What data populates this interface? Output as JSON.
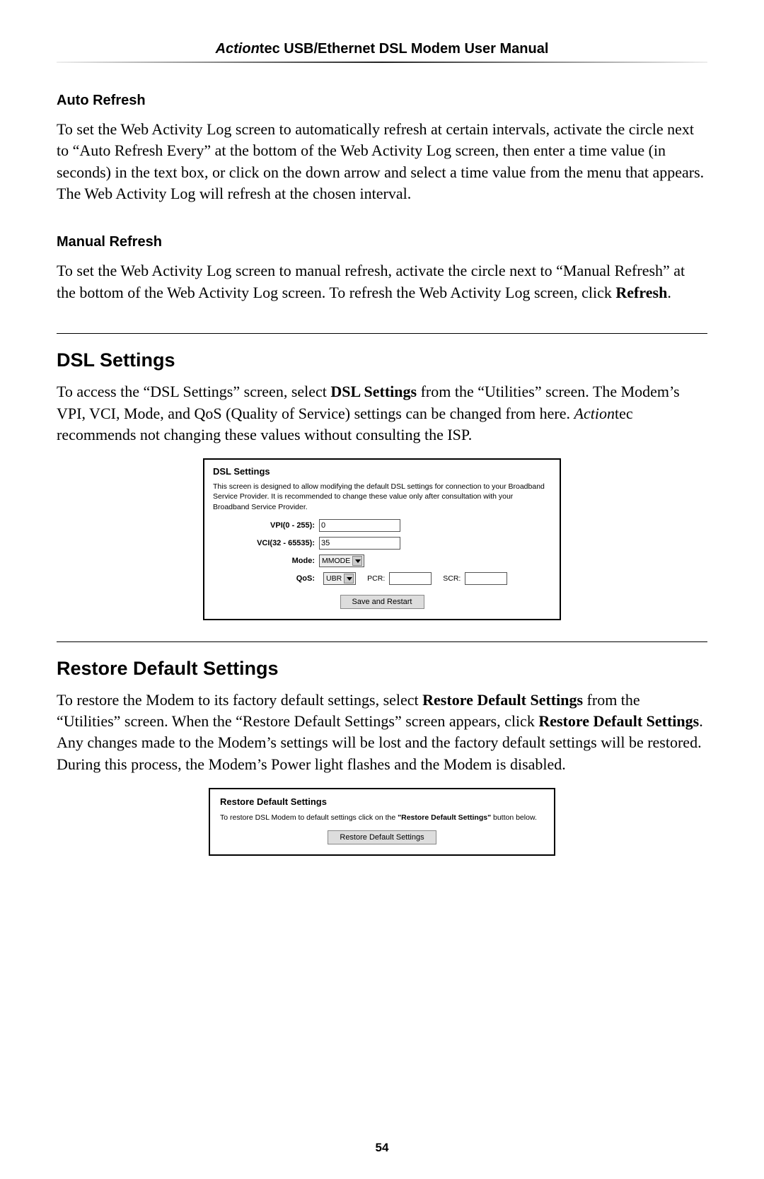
{
  "header": {
    "brand_italic": "Action",
    "brand_rest": "tec USB/Ethernet DSL Modem User Manual"
  },
  "sections": {
    "auto_refresh": {
      "heading": "Auto Refresh",
      "body": "To set the Web Activity Log screen to automatically refresh at certain intervals, activate the circle next to “Auto Refresh Every” at the bottom of the Web Activity Log screen, then enter a time value (in seconds) in the text box, or click on the down arrow and select a time value from the menu that appears. The Web Activity Log will refresh at the chosen interval."
    },
    "manual_refresh": {
      "heading": "Manual Refresh",
      "body_pre": "To set the Web Activity Log screen to manual refresh, activate the circle next to “Manual Refresh” at the bottom of the Web Activity Log screen. To refresh the Web Activity Log screen, click ",
      "body_bold": "Refresh",
      "body_post": "."
    },
    "dsl_settings": {
      "heading": "DSL Settings",
      "body_1": "To access the “DSL Settings” screen, select ",
      "body_bold1": "DSL Settings",
      "body_2": " from the “Utilities” screen. The Modem’s VPI, VCI, Mode, and QoS (Quality of Service) settings can be changed from here. ",
      "body_italic": "Action",
      "body_3": "tec recommends not changing these values without consulting the ISP."
    },
    "restore": {
      "heading": "Restore Default Settings",
      "body_1": "To restore the Modem to its factory default settings, select ",
      "body_bold1": "Restore Default Settings",
      "body_2": " from the “Utilities” screen. When the “Restore Default Settings” screen appears, click ",
      "body_bold2": "Restore Default Settings",
      "body_3": ". Any changes made to the Modem’s settings will be lost and the factory default settings will be restored. During this process, the Modem’s Power light flashes and the Modem is disabled."
    }
  },
  "dsl_panel": {
    "title": "DSL Settings",
    "desc": "This screen is designed to allow modifying the default DSL settings for connection to your Broadband Service Provider. It is recommended to change these value only after consultation with your Broadband Service Provider.",
    "vpi_label": "VPI(0 - 255):",
    "vpi_value": "0",
    "vci_label": "VCI(32 - 65535):",
    "vci_value": "35",
    "mode_label": "Mode:",
    "mode_value": "MMODE",
    "qos_label": "QoS:",
    "qos_value": "UBR",
    "pcr_label": "PCR:",
    "scr_label": "SCR:",
    "button": "Save and Restart"
  },
  "restore_panel": {
    "title": "Restore Default Settings",
    "desc_pre": "To restore DSL Modem to default settings click on the ",
    "desc_bold": "\"Restore Default Settings\"",
    "desc_post": " button below.",
    "button": "Restore Default Settings"
  },
  "page_number": "54"
}
